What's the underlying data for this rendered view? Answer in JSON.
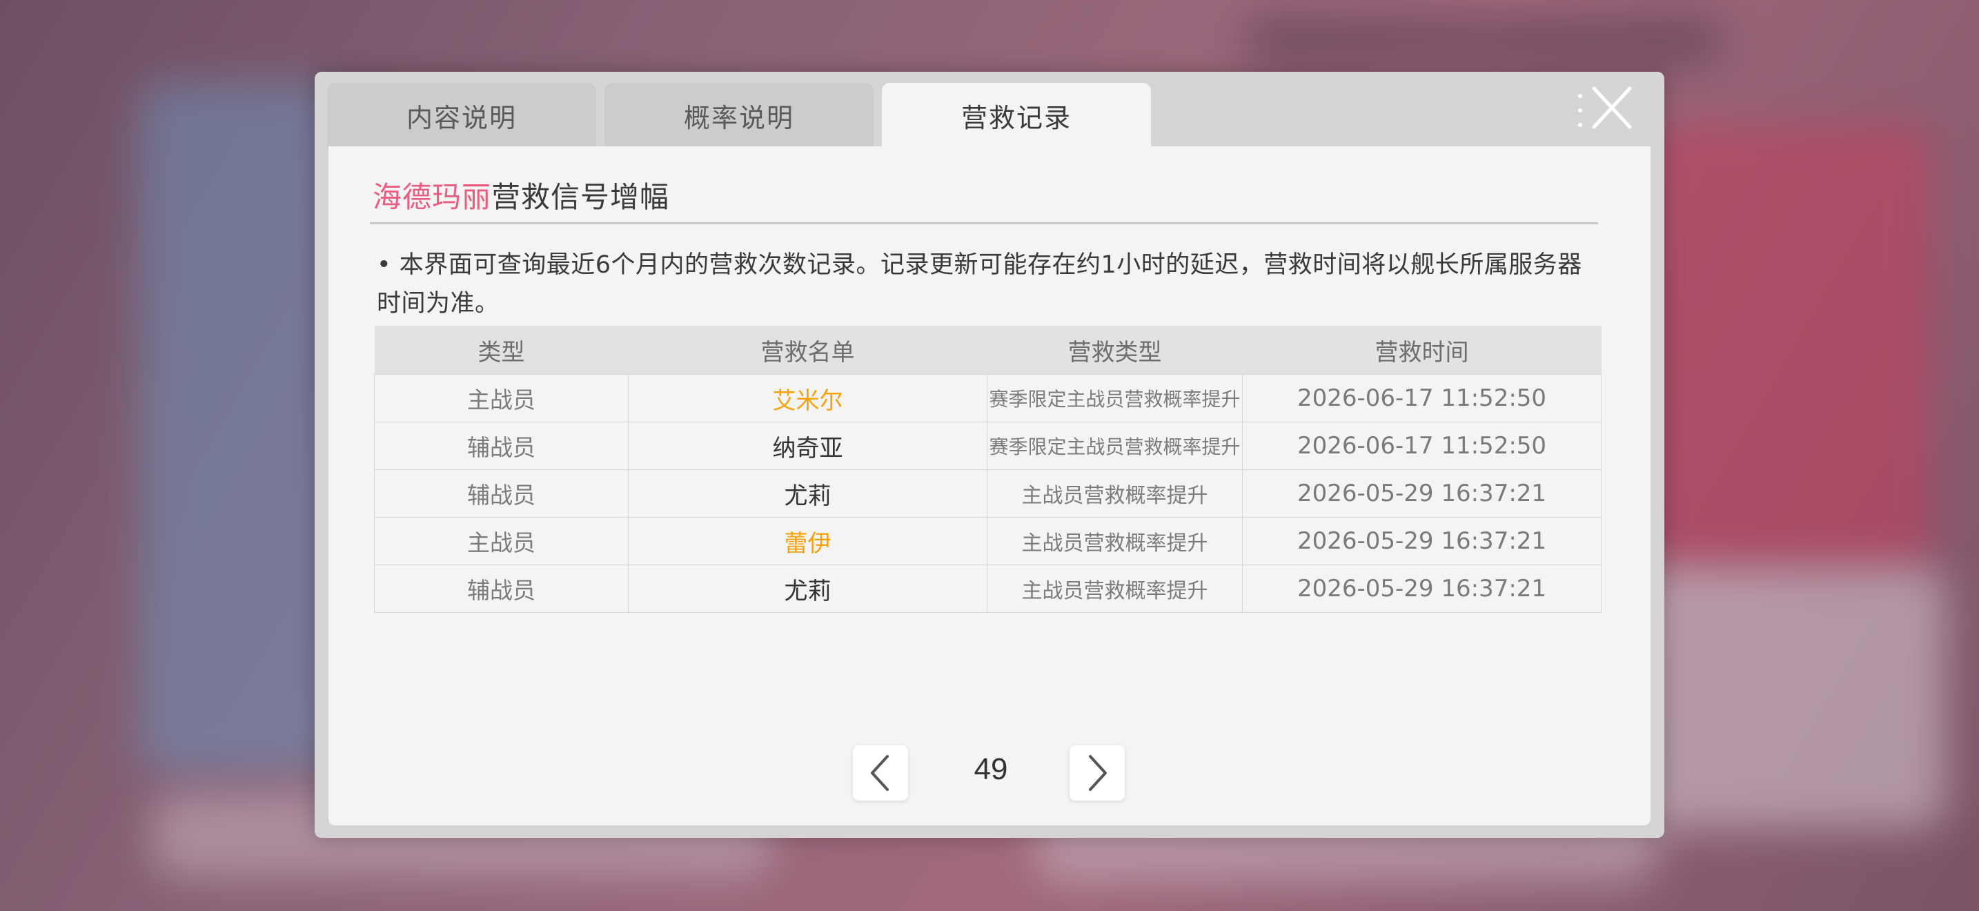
{
  "tabs": [
    {
      "label": "内容说明",
      "active": false
    },
    {
      "label": "概率说明",
      "active": false
    },
    {
      "label": "营救记录",
      "active": true
    }
  ],
  "title": {
    "highlight": "海德玛丽",
    "rest": "营救信号增幅",
    "highlight_color": "#e85c82"
  },
  "note": "• 本界面可查询最近6个月内的营救次数记录。记录更新可能存在约1小时的延迟，营救时间将以舰长所属服务器时间为准。",
  "table": {
    "headers": [
      "类型",
      "营救名单",
      "营救类型",
      "营救时间"
    ],
    "rows": [
      {
        "kind": "主战员",
        "name": "艾米尔",
        "name_color": "#f4a20d",
        "type": "赛季限定主战员营救概率提升",
        "time": "2026-06-17 11:52:50"
      },
      {
        "kind": "辅战员",
        "name": "纳奇亚",
        "name_color": "#333333",
        "type": "赛季限定主战员营救概率提升",
        "time": "2026-06-17 11:52:50"
      },
      {
        "kind": "辅战员",
        "name": "尤莉",
        "name_color": "#333333",
        "type": "主战员营救概率提升",
        "time": "2026-05-29 16:37:21"
      },
      {
        "kind": "主战员",
        "name": "蕾伊",
        "name_color": "#f4a20d",
        "type": "主战员营救概率提升",
        "time": "2026-05-29 16:37:21"
      },
      {
        "kind": "辅战员",
        "name": "尤莉",
        "name_color": "#333333",
        "type": "主战员营救概率提升",
        "time": "2026-05-29 16:37:21"
      }
    ]
  },
  "pagination": {
    "page": "49"
  },
  "icons": {
    "close": "close-icon",
    "more": "more-dots-icon",
    "prev": "chevron-left-icon",
    "next": "chevron-right-icon"
  }
}
